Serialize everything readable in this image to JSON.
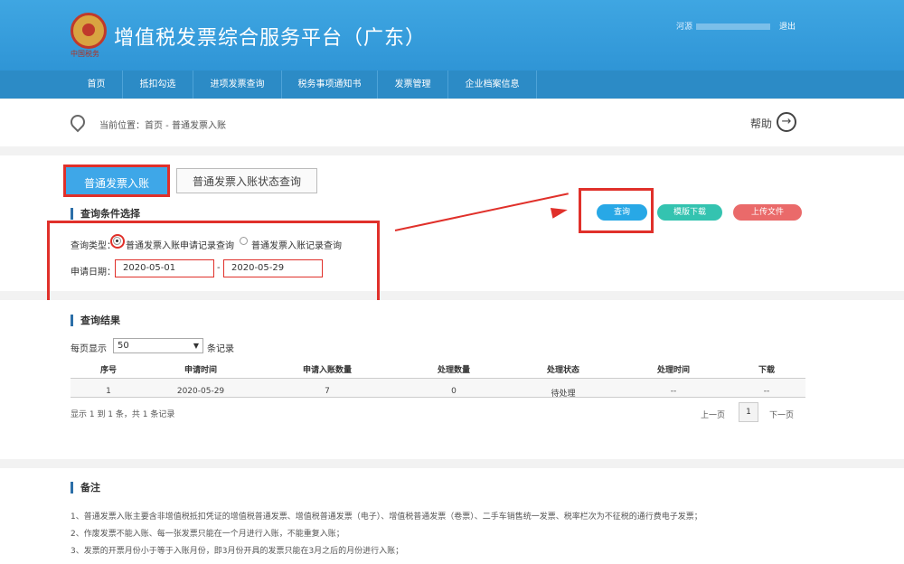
{
  "header": {
    "emblem_text": "中国税务",
    "title": "增值税发票综合服务平台（广东）",
    "user_prefix": "河源",
    "logout": "退出"
  },
  "nav": [
    "首页",
    "抵扣勾选",
    "进项发票查询",
    "税务事项通知书",
    "发票管理",
    "企业档案信息"
  ],
  "breadcrumb": {
    "text": "当前位置：首页 - 普通发票入账",
    "help": "帮助",
    "help_icon": "→"
  },
  "tabs": {
    "active": "普通发票入账",
    "other": "普通发票入账状态查询"
  },
  "query": {
    "section_title": "查询条件选择",
    "type_label": "查询类型：",
    "option1": "普通发票入账申请记录查询",
    "option2": "普通发票入账记录查询",
    "date_label": "申请日期：",
    "date_from": "2020-05-01",
    "date_sep": "-",
    "date_to": "2020-05-29"
  },
  "buttons": {
    "query": "查询",
    "template": "模版下载",
    "upload": "上传文件"
  },
  "colors": {
    "query": "#28a8e6",
    "template": "#34c3b0",
    "upload": "#ea6a6a",
    "highlight": "#e0302a"
  },
  "results": {
    "section_title": "查询结果",
    "per_page_prefix": "每页显示",
    "per_page_value": "50",
    "per_page_suffix": "条记录",
    "columns": [
      "序号",
      "申请时间",
      "申请入账数量",
      "处理数量",
      "处理状态",
      "处理时间",
      "下载"
    ],
    "rows": [
      [
        "1",
        "2020-05-29",
        "7",
        "0",
        "待处理",
        "--",
        "--"
      ]
    ],
    "summary": "显示 1 到 1 条，共 1 条记录",
    "prev": "上一页",
    "page": "1",
    "next": "下一页"
  },
  "notes": {
    "title": "备注",
    "items": [
      "1、普通发票入账主要含非增值税抵扣凭证的增值税普通发票、增值税普通发票（电子）、增值税普通发票（卷票）、二手车销售统一发票、税率栏次为不征税的通行费电子发票；",
      "2、作废发票不能入账、每一张发票只能在一个月进行入账，不能重复入账；",
      "3、发票的开票月份小于等于入账月份，即3月份开具的发票只能在3月之后的月份进行入账；"
    ]
  }
}
